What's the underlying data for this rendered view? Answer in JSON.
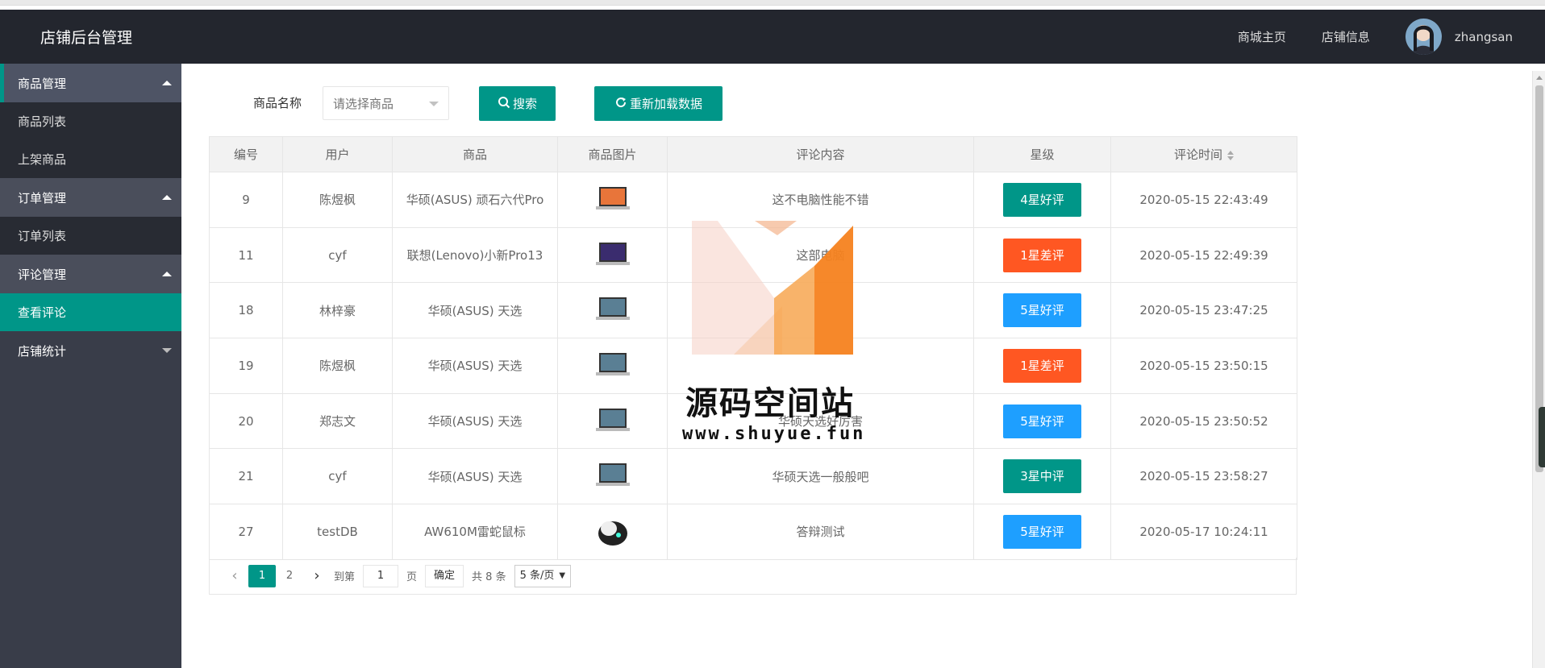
{
  "header": {
    "title": "店铺后台管理",
    "nav": [
      "商城主页",
      "店铺信息"
    ],
    "username": "zhangsan"
  },
  "sidebar": {
    "groups": [
      {
        "label": "商品管理",
        "items": [
          "商品列表",
          "上架商品"
        ]
      },
      {
        "label": "订单管理",
        "items": [
          "订单列表"
        ]
      },
      {
        "label": "评论管理",
        "items": [
          "查看评论"
        ]
      },
      {
        "label": "店铺统计",
        "items": []
      }
    ],
    "selected": "查看评论"
  },
  "search": {
    "label": "商品名称",
    "select_placeholder": "请选择商品",
    "search_button": "搜索",
    "reload_button": "重新加载数据"
  },
  "table": {
    "columns": [
      "编号",
      "用户",
      "商品",
      "商品图片",
      "评论内容",
      "星级",
      "评论时间"
    ],
    "rows": [
      {
        "id": "9",
        "user": "陈煜枫",
        "product": "华硕(ASUS) 顽石六代Pro",
        "comment": "这不电脑性能不错",
        "rating": "4星好评",
        "time": "2020-05-15 22:43:49"
      },
      {
        "id": "11",
        "user": "cyf",
        "product": "联想(Lenovo)小新Pro13",
        "comment": "这部电脑",
        "rating": "1星差评",
        "time": "2020-05-15 22:49:39"
      },
      {
        "id": "18",
        "user": "林梓豪",
        "product": "华硕(ASUS) 天选",
        "comment": "",
        "rating": "5星好评",
        "time": "2020-05-15 23:47:25"
      },
      {
        "id": "19",
        "user": "陈煜枫",
        "product": "华硕(ASUS) 天选",
        "comment": "",
        "rating": "1星差评",
        "time": "2020-05-15 23:50:15"
      },
      {
        "id": "20",
        "user": "郑志文",
        "product": "华硕(ASUS) 天选",
        "comment": "华硕天选好厉害",
        "rating": "5星好评",
        "time": "2020-05-15 23:50:52"
      },
      {
        "id": "21",
        "user": "cyf",
        "product": "华硕(ASUS) 天选",
        "comment": "华硕天选一般般吧",
        "rating": "3星中评",
        "time": "2020-05-15 23:58:27"
      },
      {
        "id": "27",
        "user": "testDB",
        "product": "AW610M雷蛇鼠标",
        "comment": "答辩测试",
        "rating": "5星好评",
        "time": "2020-05-17 10:24:11"
      }
    ]
  },
  "rating_colors": {
    "4星好评": "#009688",
    "1星差评": "#ff5722",
    "5星好评": "#1e9fff",
    "3星中评": "#009688"
  },
  "pager": {
    "pages": [
      "1",
      "2"
    ],
    "current": "1",
    "goto_label": "到第",
    "goto_value": "1",
    "page_unit": "页",
    "confirm": "确定",
    "total": "共 8 条",
    "limit": "5 条/页"
  },
  "watermark": {
    "name": "源码空间站",
    "url": "www.shuyue.fun"
  }
}
